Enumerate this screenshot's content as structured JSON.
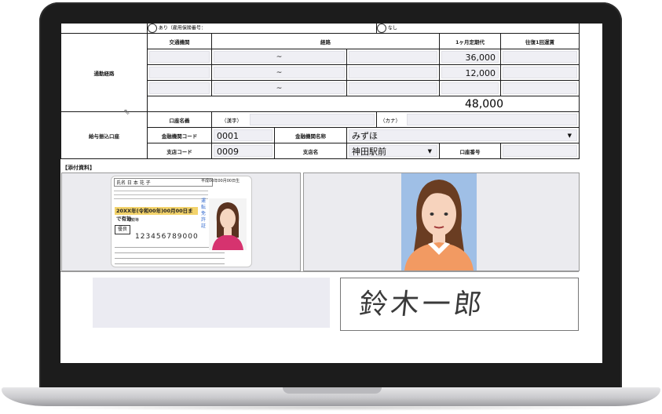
{
  "form": {
    "top_partial": {
      "radio_yes_label": "あり（雇用保険番号：",
      "radio_no_label": "なし"
    },
    "commute": {
      "section_label": "通勤経路",
      "headers": {
        "transport": "交通機関",
        "route": "経路",
        "monthly_pass": "1ヶ月定期代",
        "round_trip": "往復1回運賃"
      },
      "rows": [
        {
          "route_sep": "~",
          "monthly_pass": "36,000"
        },
        {
          "route_sep": "~",
          "monthly_pass": "12,000"
        },
        {
          "route_sep": "~",
          "monthly_pass": ""
        }
      ],
      "total": "48,000"
    },
    "bank": {
      "section_label": "給与振込口座",
      "account_name_label": "口座名義",
      "kanji_label": "（漢字）",
      "kana_label": "（カナ）",
      "bank_code_label": "金融機関コード",
      "bank_code": "0001",
      "bank_name_label": "金融機関名称",
      "bank_name": "みずほ",
      "branch_code_label": "支店コード",
      "branch_code": "0009",
      "branch_name_label": "支店名",
      "branch_name": "神田駅前",
      "account_number_label": "口座番号",
      "dropdown_arrow": "▼"
    },
    "attachments": {
      "title": "【添付資料】"
    },
    "license": {
      "name_field": "氏名  日 本  花 子",
      "birth": "平成00年00月00日生",
      "expiry": "20XX年(令和00年)00月00日まで有効",
      "condition": "眼鏡等",
      "badge": "優良",
      "number": "123456789000",
      "side_text": "運転免許証"
    },
    "signature": {
      "text": "鈴木一郎"
    }
  }
}
